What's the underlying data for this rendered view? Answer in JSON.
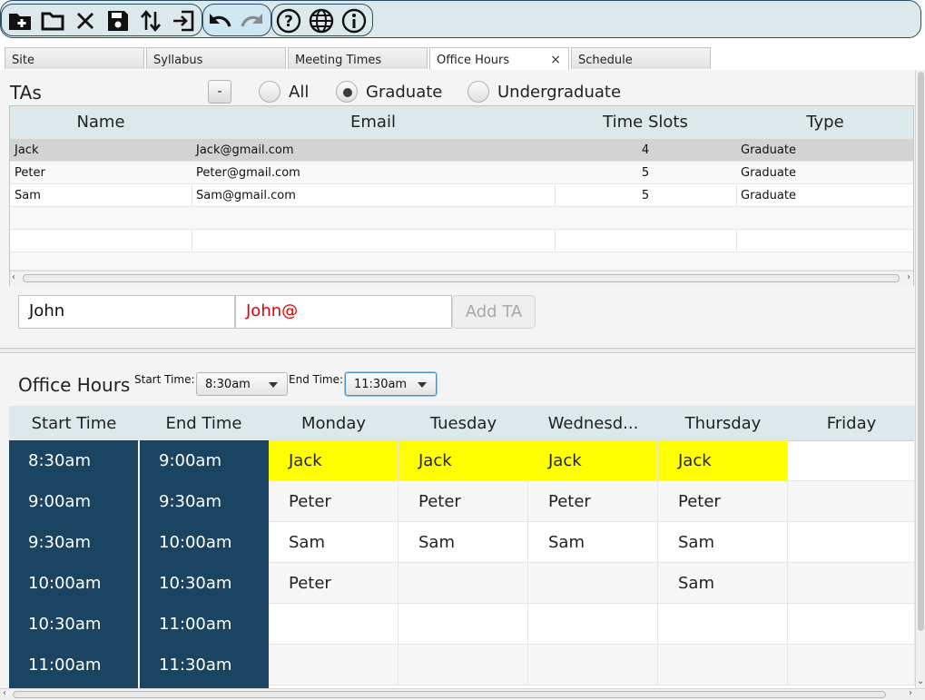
{
  "toolbar": {
    "file_group": [
      "new-icon",
      "open-folder-icon",
      "close-icon",
      "save-icon",
      "sort-icon",
      "export-icon"
    ],
    "edit_group": [
      "undo-icon",
      "redo-icon"
    ],
    "help_group": [
      "help-icon",
      "language-icon",
      "info-icon"
    ]
  },
  "tabs": [
    {
      "label": "Site"
    },
    {
      "label": "Syllabus"
    },
    {
      "label": "Meeting Times"
    },
    {
      "label": "Office Hours",
      "selected": true,
      "close": "×"
    },
    {
      "label": "Schedule"
    }
  ],
  "tas": {
    "title": "TAs",
    "remove_label": "-",
    "filters": [
      {
        "label": "All",
        "selected": false
      },
      {
        "label": "Graduate",
        "selected": true
      },
      {
        "label": "Undergraduate",
        "selected": false
      }
    ],
    "columns": [
      "Name",
      "Email",
      "Time Slots",
      "Type"
    ],
    "rows": [
      {
        "name": "Jack",
        "email": "Jack@gmail.com",
        "slots": "4",
        "type": "Graduate",
        "selected": true
      },
      {
        "name": "Peter",
        "email": "Peter@gmail.com",
        "slots": "5",
        "type": "Graduate"
      },
      {
        "name": "Sam",
        "email": "Sam@gmail.com",
        "slots": "5",
        "type": "Graduate"
      }
    ],
    "name_value": "John",
    "email_value": "John@",
    "add_label": "Add TA"
  },
  "office_hours": {
    "title": "Office Hours",
    "start_label": "Start Time:",
    "start_value": "8:30am",
    "end_label": "End Time:",
    "end_value": "11:30am",
    "columns": [
      "Start Time",
      "End Time",
      "Monday",
      "Tuesday",
      "Wednesd...",
      "Thursday",
      "Friday"
    ],
    "rows": [
      {
        "start": "8:30am",
        "end": "9:00am",
        "days": [
          "Jack",
          "Jack",
          "Jack",
          "Jack",
          ""
        ]
      },
      {
        "start": "9:00am",
        "end": "9:30am",
        "days": [
          "Peter",
          "Peter",
          "Peter",
          "Peter",
          ""
        ]
      },
      {
        "start": "9:30am",
        "end": "10:00am",
        "days": [
          "Sam",
          "Sam",
          "Sam",
          "Sam",
          ""
        ]
      },
      {
        "start": "10:00am",
        "end": "10:30am",
        "days": [
          "Peter",
          "",
          "",
          "Sam",
          ""
        ]
      },
      {
        "start": "10:30am",
        "end": "11:00am",
        "days": [
          "",
          "",
          "",
          "",
          ""
        ]
      },
      {
        "start": "11:00am",
        "end": "11:30am",
        "days": [
          "",
          "",
          "",
          "",
          ""
        ]
      }
    ],
    "highlight_color": "#ffff00",
    "time_column_color": "#1b4462"
  }
}
